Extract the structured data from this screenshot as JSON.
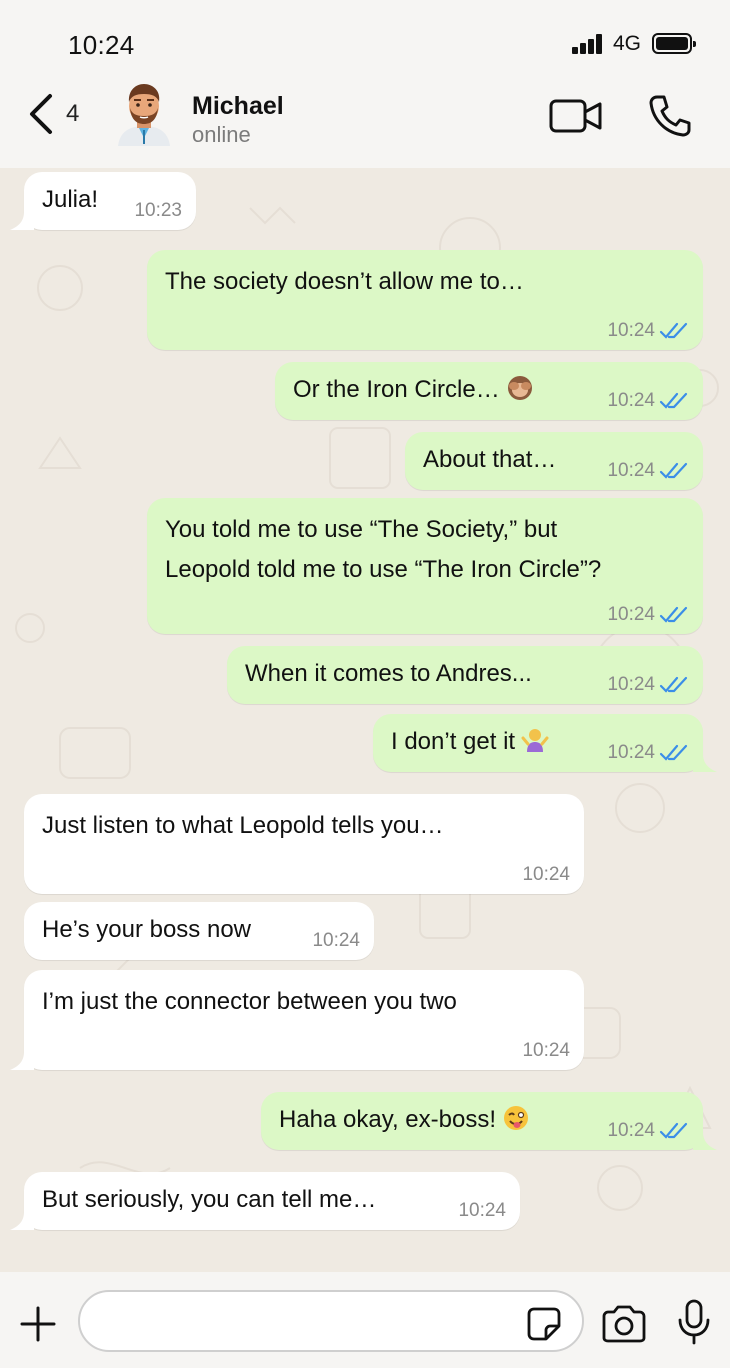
{
  "status_bar": {
    "time": "10:24",
    "network": "4G"
  },
  "header": {
    "back_count": "4",
    "contact_name": "Michael",
    "contact_status": "online"
  },
  "messages": [
    {
      "direction": "in",
      "text": "Julia!",
      "time": "10:23"
    },
    {
      "direction": "out",
      "text": "The society doesn’t allow me to…",
      "time": "10:24",
      "read": true
    },
    {
      "direction": "out",
      "text": "Or the Iron Circle…",
      "emoji": "see-no-evil-monkey",
      "time": "10:24",
      "read": true
    },
    {
      "direction": "out",
      "text": "About that…",
      "time": "10:24",
      "read": true
    },
    {
      "direction": "out",
      "text_lines": [
        "You told me to use “The Society,” but",
        "Leopold told me to use “The Iron Circle”?"
      ],
      "time": "10:24",
      "read": true
    },
    {
      "direction": "out",
      "text": "When it comes to Andres...",
      "time": "10:24",
      "read": true
    },
    {
      "direction": "out",
      "text": "I don’t get it",
      "emoji": "person-shrugging",
      "time": "10:24",
      "read": true
    },
    {
      "direction": "in",
      "text": "Just listen to what Leopold tells you…",
      "time": "10:24"
    },
    {
      "direction": "in",
      "text": "He’s your boss now",
      "time": "10:24"
    },
    {
      "direction": "in",
      "text": "I’m just the connector between you two",
      "time": "10:24"
    },
    {
      "direction": "out",
      "text": "Haha okay, ex-boss!",
      "emoji": "winking-face-with-tongue",
      "time": "10:24",
      "read": true
    },
    {
      "direction": "in",
      "text": "But seriously, you can tell me…",
      "time": "10:24"
    }
  ],
  "composer": {
    "placeholder": ""
  },
  "colors": {
    "incoming": "#ffffff",
    "outgoing": "#dcf8c6",
    "read_ticks": "#3b8ee8",
    "background": "#efeae2"
  }
}
